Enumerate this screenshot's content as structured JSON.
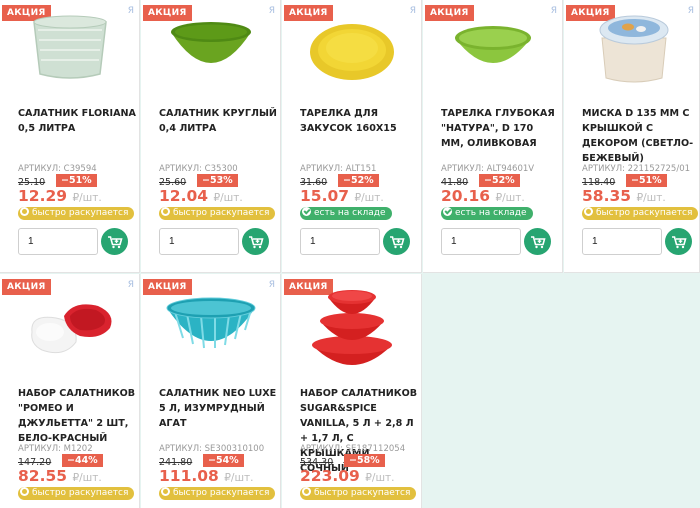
{
  "promo_label": "АКЦИЯ",
  "ya_mark": "Я",
  "unit": "₽/шт.",
  "products": [
    {
      "title": "САЛАТНИК FLORIANA 0,5 ЛИТРА",
      "sku": "АРТИКУЛ: C39594",
      "old_price": "25.10",
      "discount": "−51%",
      "price": "12.29",
      "badge": "быстро раскупается",
      "badge_type": "sell",
      "qty": "1",
      "icon": "square-bowl-image"
    },
    {
      "title": "САЛАТНИК КРУГЛЫЙ 0,4 ЛИТРА",
      "sku": "АРТИКУЛ: C35300",
      "old_price": "25.60",
      "discount": "−53%",
      "price": "12.04",
      "badge": "быстро раскупается",
      "badge_type": "sell",
      "qty": "1",
      "icon": "green-bowl-image"
    },
    {
      "title": "ТАРЕЛКА ДЛЯ ЗАКУСОК 160Х15",
      "sku": "АРТИКУЛ: ALT151",
      "old_price": "31.60",
      "discount": "−52%",
      "price": "15.07",
      "badge": "есть на складе",
      "badge_type": "stock",
      "qty": "1",
      "icon": "yellow-plate-image"
    },
    {
      "title": "ТАРЕЛКА ГЛУБОКАЯ \"НАТУРА\", D 170 ММ, ОЛИВКОВАЯ",
      "sku": "АРТИКУЛ: ALT94601V",
      "old_price": "41.80",
      "discount": "−52%",
      "price": "20.16",
      "badge": "есть на складе",
      "badge_type": "stock",
      "qty": "1",
      "icon": "olive-bowl-image"
    },
    {
      "title": "МИСКА D 135 ММ С КРЫШКОЙ С ДЕКОРОМ (СВЕТЛО-БЕЖЕВЫЙ)",
      "sku": "АРТИКУЛ: 221152725/01",
      "old_price": "118.40",
      "discount": "−51%",
      "price": "58.35",
      "badge": "быстро раскупается",
      "badge_type": "sell",
      "qty": "1",
      "icon": "lidded-bowl-image"
    },
    {
      "title": "НАБОР САЛАТНИКОВ \"РОМЕО И ДЖУЛЬЕТТА\" 2 ШТ, БЕЛО-КРАСНЫЙ",
      "sku": "АРТИКУЛ: M1202",
      "old_price": "147.20",
      "discount": "−44%",
      "price": "82.55",
      "badge": "быстро раскупается",
      "badge_type": "sell",
      "qty": "1",
      "icon": "heart-bowls-image"
    },
    {
      "title": "САЛАТНИК NEO LUXE 5 Л, ИЗУМРУДНЫЙ АГАТ",
      "sku": "АРТИКУЛ: SE300310100",
      "old_price": "241.80",
      "discount": "−54%",
      "price": "111.08",
      "badge": "быстро раскупается",
      "badge_type": "sell",
      "qty": "1",
      "icon": "teal-bowl-image"
    },
    {
      "title": "НАБОР САЛАТНИКОВ SUGAR&SPICE VANILLA, 5 Л + 2,8 Л + 1,7 Л, С КРЫШКАМИ, СОЧНЫЙ",
      "sku": "АРТИКУЛ: SE187112054",
      "old_price": "534.30",
      "discount": "−58%",
      "price": "223.09",
      "badge": "быстро раскупается",
      "badge_type": "sell",
      "qty": "1",
      "icon": "red-bowls-image"
    }
  ],
  "colors": {
    "accent": "#e8604c",
    "cart": "#27a571",
    "sell": "#e2c03e",
    "stock": "#3fb06b",
    "background": "#e6f4f1"
  }
}
